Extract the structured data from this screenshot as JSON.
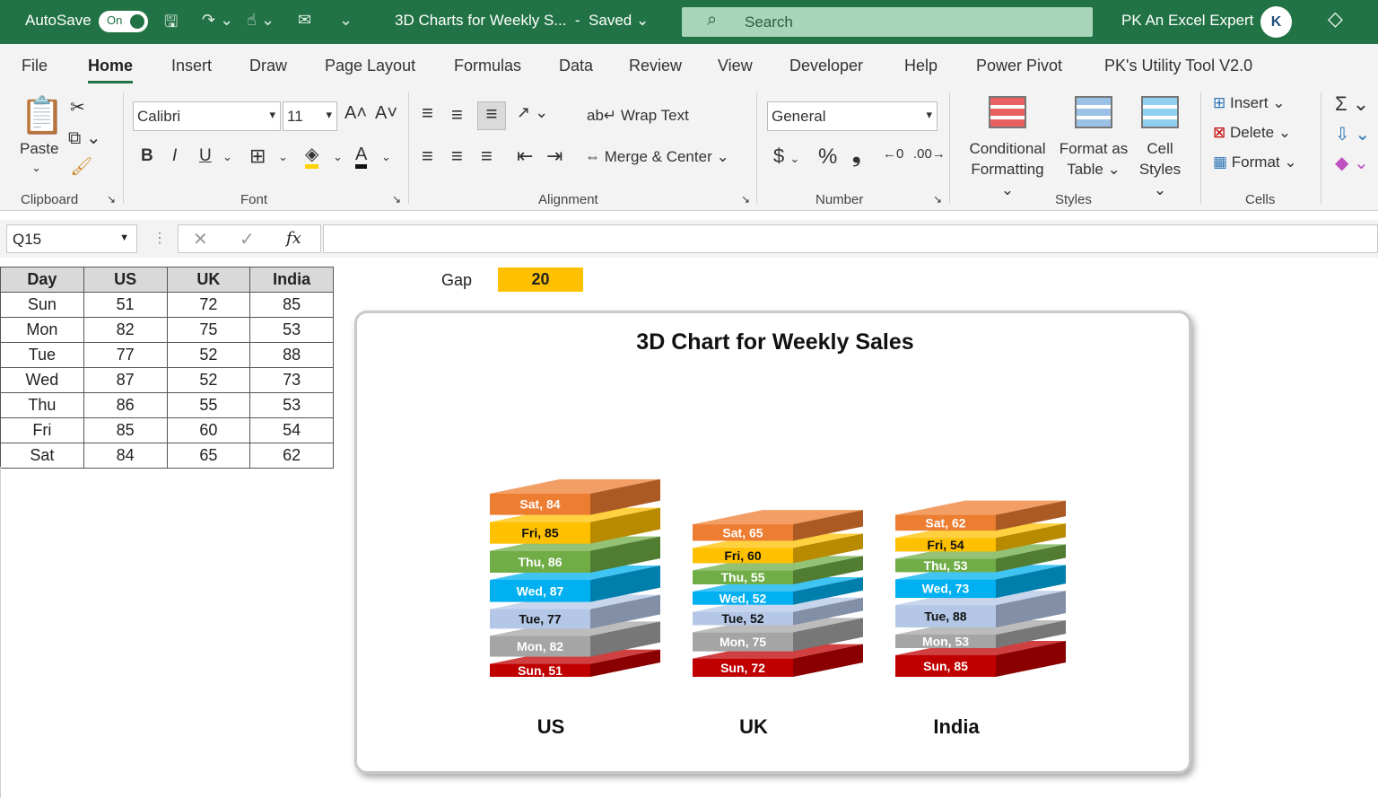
{
  "titlebar": {
    "autosave_label": "AutoSave",
    "autosave_state": "On",
    "doc_title": "3D Charts for Weekly S...",
    "save_state": "Saved",
    "search_placeholder": "Search",
    "user_name": "PK An Excel Expert"
  },
  "tabs": [
    "File",
    "Home",
    "Insert",
    "Draw",
    "Page Layout",
    "Formulas",
    "Data",
    "Review",
    "View",
    "Developer",
    "Help",
    "Power Pivot",
    "PK's Utility Tool V2.0"
  ],
  "active_tab": "Home",
  "ribbon": {
    "clipboard": {
      "paste": "Paste",
      "label": "Clipboard"
    },
    "font": {
      "name": "Calibri",
      "size": "11",
      "label": "Font",
      "bold": "B",
      "italic": "I",
      "underline": "U"
    },
    "alignment": {
      "wrap": "Wrap Text",
      "merge": "Merge & Center",
      "label": "Alignment"
    },
    "number": {
      "format": "General",
      "label": "Number",
      "currency": "$",
      "percent": "%"
    },
    "styles": {
      "cond1": "Conditional",
      "cond2": "Formatting",
      "table1": "Format as",
      "table2": "Table",
      "cell1": "Cell",
      "cell2": "Styles",
      "label": "Styles"
    },
    "cells": {
      "insert": "Insert",
      "delete": "Delete",
      "format": "Format",
      "label": "Cells"
    }
  },
  "formula_bar": {
    "name_box": "Q15",
    "fx": "fx",
    "value": ""
  },
  "table": {
    "headers": [
      "Day",
      "US",
      "UK",
      "India"
    ],
    "rows": [
      [
        "Sun",
        "51",
        "72",
        "85"
      ],
      [
        "Mon",
        "82",
        "75",
        "53"
      ],
      [
        "Tue",
        "77",
        "52",
        "88"
      ],
      [
        "Wed",
        "87",
        "52",
        "73"
      ],
      [
        "Thu",
        "86",
        "55",
        "53"
      ],
      [
        "Fri",
        "85",
        "60",
        "54"
      ],
      [
        "Sat",
        "84",
        "65",
        "62"
      ]
    ]
  },
  "gap": {
    "label": "Gap",
    "value": "20"
  },
  "chart_data": {
    "type": "bar",
    "stacked": true,
    "title": "3D Chart for Weekly Sales",
    "categories": [
      "US",
      "UK",
      "India"
    ],
    "series": [
      {
        "name": "Sun",
        "values": [
          51,
          72,
          85
        ],
        "color": "#c00000"
      },
      {
        "name": "Mon",
        "values": [
          82,
          75,
          53
        ],
        "color": "#a5a5a5"
      },
      {
        "name": "Tue",
        "values": [
          77,
          52,
          88
        ],
        "color": "#b4c7e7"
      },
      {
        "name": "Wed",
        "values": [
          87,
          52,
          73
        ],
        "color": "#00b0f0"
      },
      {
        "name": "Thu",
        "values": [
          86,
          55,
          53
        ],
        "color": "#70ad47"
      },
      {
        "name": "Fri",
        "values": [
          85,
          60,
          54
        ],
        "color": "#ffc000"
      },
      {
        "name": "Sat",
        "values": [
          84,
          65,
          62
        ],
        "color": "#ed7d31"
      }
    ],
    "gap": 20,
    "grid": false,
    "legend": "none"
  },
  "colors": {
    "excel_green": "#217346",
    "gap_fill": "#ffc000"
  }
}
